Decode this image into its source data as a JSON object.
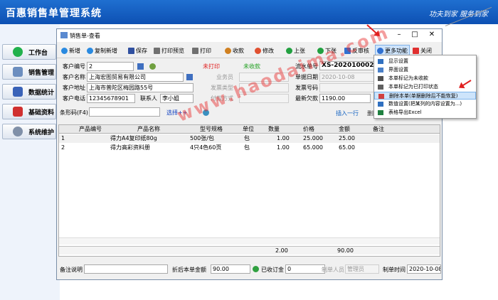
{
  "app": {
    "title": "百惠销售单管理系统",
    "slogan": "功夫到家  服务到家"
  },
  "sidebar": {
    "items": [
      {
        "label": "工作台",
        "color": "#22b14c"
      },
      {
        "label": "销售管理",
        "color": "#6c8ebf"
      },
      {
        "label": "数据统计",
        "color": "#3a63b8"
      },
      {
        "label": "基础资料",
        "color": "#d03030"
      },
      {
        "label": "系统维护",
        "color": "#8090a8"
      }
    ]
  },
  "window": {
    "title": "销售单-查看"
  },
  "toolbar": {
    "new": "新增",
    "copy_new": "复制新增",
    "save": "保存",
    "print_preview": "打印预览",
    "print": "打印",
    "receive": "收款",
    "modify": "修改",
    "prev": "上张",
    "next": "下张",
    "unapprove": "反审核",
    "more": "更多功能",
    "close": "关闭"
  },
  "form": {
    "customer_no_label": "客户编号",
    "customer_no": "2",
    "print_status": "未打印",
    "receive_status": "未收款",
    "serial_label": "流水单号",
    "serial": "XS-202010002",
    "customer_name_label": "客户名称",
    "customer_name": "上海宏图贸易有限公司",
    "salesman_label": "业务员",
    "date_label": "单据日期",
    "date": "2020-10-08",
    "address_label": "客户地址",
    "address": "上海市普陀区梅园路55号",
    "invoice_type_label": "发票类型",
    "invoice_no_label": "发票号码",
    "phone_label": "客户电话",
    "phone": "12345678901",
    "contact_label": "联系人",
    "contact": "李小姐",
    "payment_label": "付款方式",
    "debt_label": "最新欠款",
    "debt": "1190.00",
    "barcode_label": "条形码(F4)",
    "select_btn": "选择++",
    "insert_row": "插入一行",
    "delete_row": "删除一行"
  },
  "grid": {
    "headers": [
      "产品编号",
      "产品名称",
      "型号规格",
      "单位",
      "数量",
      "价格",
      "金额",
      "备注"
    ],
    "rows": [
      {
        "idx": "1",
        "code": "",
        "name": "得力A4复印纸80g",
        "spec": "500张/包",
        "unit": "包",
        "qty": "1.00",
        "price": "25.000",
        "amount": "25.00",
        "remark": ""
      },
      {
        "idx": "2",
        "code": "",
        "name": "得力高彩资料册",
        "spec": "4只4色60页",
        "unit": "包",
        "qty": "1.00",
        "price": "65.000",
        "amount": "65.00",
        "remark": ""
      }
    ],
    "total_qty": "2.00",
    "total_amount": "90.00"
  },
  "bottom": {
    "remark_label": "备注说明",
    "discount_label": "折后本单金额",
    "discount": "90.00",
    "received_label": "已收订金",
    "received": "0",
    "creator_label": "制单人员",
    "creator": "管理员",
    "time_label": "制单时间",
    "time": "2020-10-08"
  },
  "menu": {
    "items": [
      "显示设置",
      "界面设置",
      "本单标记为未收款",
      "本单标记为已打印状态",
      "删除本单(单据删除后不能恢复)",
      "数值设置(把某列的内容设置为...)",
      "表格导出Excel"
    ]
  },
  "watermark": "www.haodaima.com"
}
